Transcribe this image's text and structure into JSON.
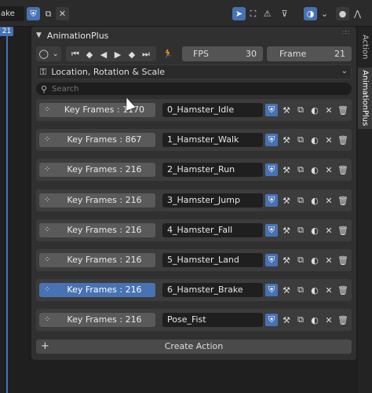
{
  "header": {
    "name_field": "ake",
    "icons": [
      "shield-icon",
      "copy-icon",
      "close-icon",
      "arrow-select-icon",
      "frame-select-icon",
      "warning-icon",
      "filter-icon",
      "ghost-icon",
      "keying-icon",
      "snap-icon",
      "proportional-icon"
    ]
  },
  "timeline": {
    "current_frame_badge": "21"
  },
  "panel": {
    "title": "AnimationPlus",
    "fps_label": "FPS",
    "fps_value": "30",
    "frame_label": "Frame",
    "frame_value": "21",
    "keying_set": "Location, Rotation & Scale",
    "search_placeholder": "Search",
    "create_action_label": "Create Action",
    "create_plus": "+"
  },
  "actions": [
    {
      "keyframes_label": "Key Frames : 1170",
      "name": "0_Hamster_Idle",
      "selected": false
    },
    {
      "keyframes_label": "Key Frames : 867",
      "name": "1_Hamster_Walk",
      "selected": false
    },
    {
      "keyframes_label": "Key Frames : 216",
      "name": "2_Hamster_Run",
      "selected": false
    },
    {
      "keyframes_label": "Key Frames : 216",
      "name": "3_Hamster_Jump",
      "selected": false
    },
    {
      "keyframes_label": "Key Frames : 216",
      "name": "4_Hamster_Fall",
      "selected": false
    },
    {
      "keyframes_label": "Key Frames : 216",
      "name": "5_Hamster_Land",
      "selected": false
    },
    {
      "keyframes_label": "Key Frames : 216",
      "name": "6_Hamster_Brake",
      "selected": true
    },
    {
      "keyframes_label": "Key Frames : 216",
      "name": "Pose_Fist",
      "selected": false
    }
  ],
  "sidebar_tabs": [
    "Action",
    "AnimationPlus"
  ],
  "colors": {
    "accent": "#4772b3",
    "panel": "#303030",
    "row": "#3c3c3c"
  }
}
